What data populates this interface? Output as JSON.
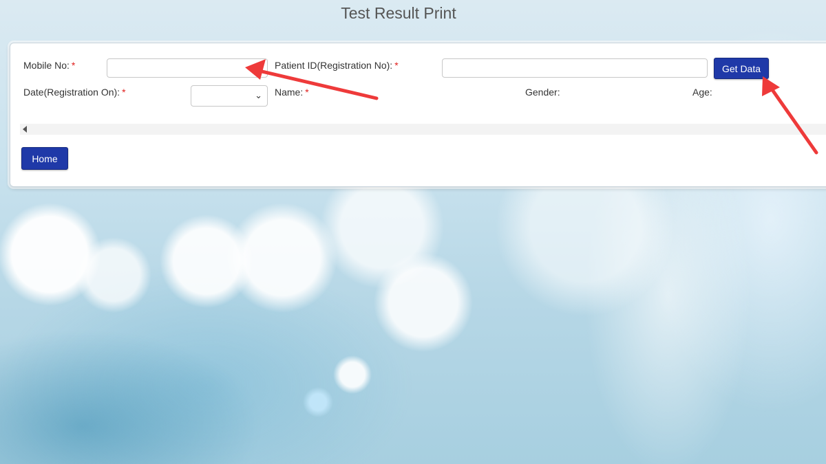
{
  "page": {
    "title": "Test Result Print"
  },
  "form": {
    "mobile_label": "Mobile No:",
    "patient_id_label": "Patient ID(Registration No):",
    "date_label": "Date(Registration On):",
    "name_label": "Name:",
    "gender_label": "Gender:",
    "age_label": "Age:",
    "required_marker": "*",
    "mobile_value": "",
    "patient_id_value": "",
    "date_selected": ""
  },
  "buttons": {
    "get_data": "Get Data",
    "home": "Home"
  },
  "colors": {
    "button_bg": "#1f39a8",
    "required": "#e0201e",
    "annotation_arrow": "#ee3a3a"
  },
  "annotations": {
    "arrow_icon": "red-arrow-icon"
  }
}
